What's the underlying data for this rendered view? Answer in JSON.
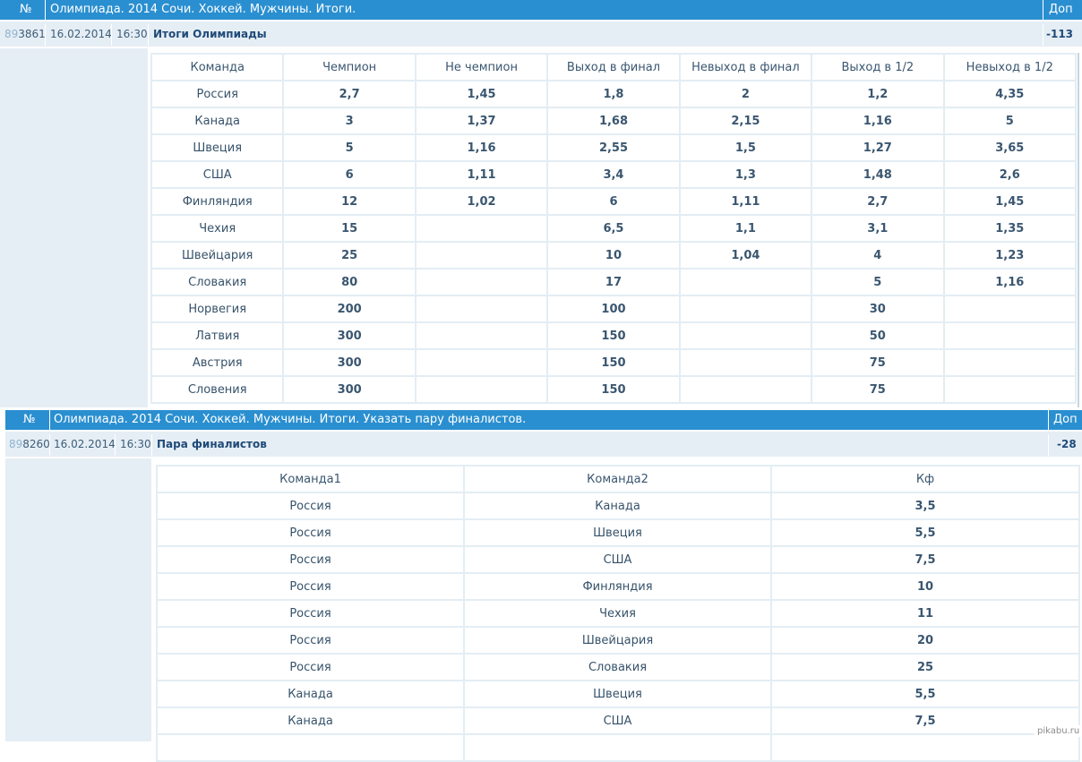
{
  "section1": {
    "header": {
      "no_label": "№",
      "title": "Олимпиада. 2014 Сочи. Хоккей. Мужчины. Итоги.",
      "extra_label": "Доп"
    },
    "event": {
      "num_prefix": "89",
      "num_rest": "3861",
      "date": "16.02.2014",
      "time": "16:30",
      "name": "Итоги Олимпиады",
      "extra_count": "-113"
    },
    "table": {
      "columns": [
        "Команда",
        "Чемпион",
        "Не чемпион",
        "Выход в финал",
        "Невыход в финал",
        "Выход в 1/2",
        "Невыход в 1/2"
      ],
      "rows": [
        [
          "Россия",
          "2,7",
          "1,45",
          "1,8",
          "2",
          "1,2",
          "4,35"
        ],
        [
          "Канада",
          "3",
          "1,37",
          "1,68",
          "2,15",
          "1,16",
          "5"
        ],
        [
          "Швеция",
          "5",
          "1,16",
          "2,55",
          "1,5",
          "1,27",
          "3,65"
        ],
        [
          "США",
          "6",
          "1,11",
          "3,4",
          "1,3",
          "1,48",
          "2,6"
        ],
        [
          "Финляндия",
          "12",
          "1,02",
          "6",
          "1,11",
          "2,7",
          "1,45"
        ],
        [
          "Чехия",
          "15",
          "",
          "6,5",
          "1,1",
          "3,1",
          "1,35"
        ],
        [
          "Швейцария",
          "25",
          "",
          "10",
          "1,04",
          "4",
          "1,23"
        ],
        [
          "Словакия",
          "80",
          "",
          "17",
          "",
          "5",
          "1,16"
        ],
        [
          "Норвегия",
          "200",
          "",
          "100",
          "",
          "30",
          ""
        ],
        [
          "Латвия",
          "300",
          "",
          "150",
          "",
          "50",
          ""
        ],
        [
          "Австрия",
          "300",
          "",
          "150",
          "",
          "75",
          ""
        ],
        [
          "Словения",
          "300",
          "",
          "150",
          "",
          "75",
          ""
        ]
      ]
    }
  },
  "section2": {
    "header": {
      "no_label": "№",
      "title": "Олимпиада. 2014 Сочи. Хоккей. Мужчины. Итоги. Указать пару финалистов.",
      "extra_label": "Доп"
    },
    "event": {
      "num_prefix": "89",
      "num_rest": "8260",
      "date": "16.02.2014",
      "time": "16:30",
      "name": "Пара финалистов",
      "extra_count": "-28"
    },
    "table": {
      "columns": [
        "Команда1",
        "Команда2",
        "Кф"
      ],
      "rows": [
        [
          "Россия",
          "Канада",
          "3,5"
        ],
        [
          "Россия",
          "Швеция",
          "5,5"
        ],
        [
          "Россия",
          "США",
          "7,5"
        ],
        [
          "Россия",
          "Финляндия",
          "10"
        ],
        [
          "Россия",
          "Чехия",
          "11"
        ],
        [
          "Россия",
          "Швейцария",
          "20"
        ],
        [
          "Россия",
          "Словакия",
          "25"
        ],
        [
          "Канада",
          "Швеция",
          "5,5"
        ],
        [
          "Канада",
          "США",
          "7,5"
        ],
        [
          "",
          "",
          ""
        ]
      ]
    }
  },
  "watermark": "pikabu.ru",
  "colors": {
    "header_bg": "#2a8fd0",
    "row_bg": "#e6eef5",
    "title_text": "#1f4a78"
  }
}
